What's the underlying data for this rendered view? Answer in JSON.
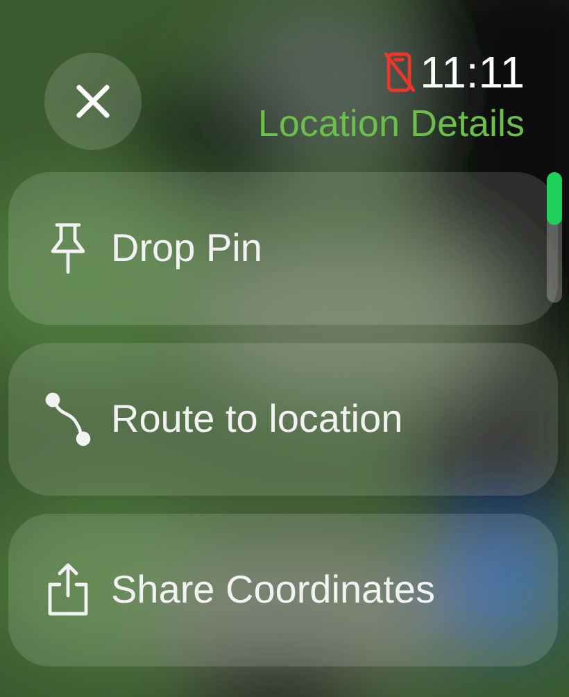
{
  "status_bar": {
    "time": "11:11"
  },
  "header": {
    "title": "Location Details"
  },
  "actions": [
    {
      "kind": "pin",
      "label": "Drop Pin"
    },
    {
      "kind": "route",
      "label": "Route to location"
    },
    {
      "kind": "share",
      "label": "Share Coordinates"
    }
  ]
}
